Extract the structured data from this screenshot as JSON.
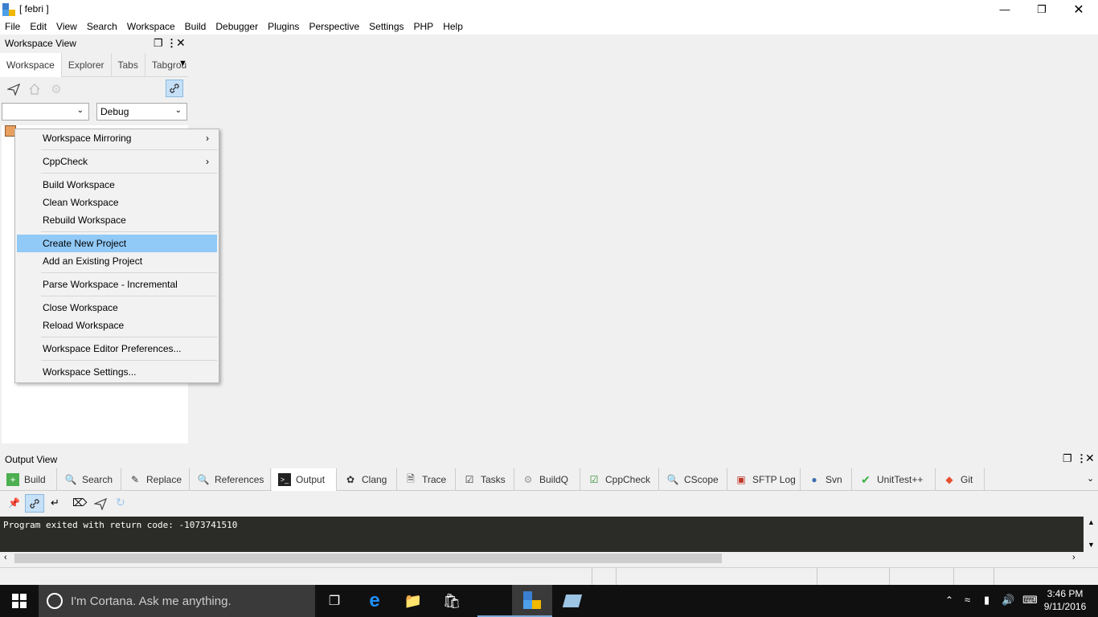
{
  "window": {
    "title": "[ febri ]"
  },
  "menubar": [
    "File",
    "Edit",
    "View",
    "Search",
    "Workspace",
    "Build",
    "Debugger",
    "Plugins",
    "Perspective",
    "Settings",
    "PHP",
    "Help"
  ],
  "workspace_view": {
    "title": "Workspace View",
    "tabs": [
      "Workspace",
      "Explorer",
      "Tabs",
      "Tabgrou"
    ],
    "config_combo": "",
    "build_combo": "Debug"
  },
  "context_menu": {
    "items": [
      {
        "label": "Workspace Mirroring",
        "submenu": true
      },
      {
        "label": "CppCheck",
        "submenu": true
      },
      {
        "label": "Build Workspace"
      },
      {
        "label": "Clean Workspace"
      },
      {
        "label": "Rebuild Workspace"
      },
      {
        "label": "Create New Project",
        "highlighted": true
      },
      {
        "label": "Add an Existing Project"
      },
      {
        "label": "Parse Workspace - Incremental"
      },
      {
        "label": "Close Workspace"
      },
      {
        "label": "Reload Workspace"
      },
      {
        "label": "Workspace Editor Preferences..."
      },
      {
        "label": "Workspace Settings..."
      }
    ]
  },
  "output_view": {
    "title": "Output View",
    "tabs": [
      "Build",
      "Search",
      "Replace",
      "References",
      "Output",
      "Clang",
      "Trace",
      "Tasks",
      "BuildQ",
      "CppCheck",
      "CScope",
      "SFTP Log",
      "Svn",
      "UnitTest++",
      "Git"
    ],
    "active_tab": "Output",
    "console_text": "Program exited with return code: -1073741510"
  },
  "taskbar": {
    "search_placeholder": "I'm Cortana. Ask me anything.",
    "time": "3:46 PM",
    "date": "9/11/2016"
  },
  "colors": {
    "highlight": "#91c9f7",
    "console_bg": "#2b2b27",
    "taskbar_bg": "#101010"
  }
}
